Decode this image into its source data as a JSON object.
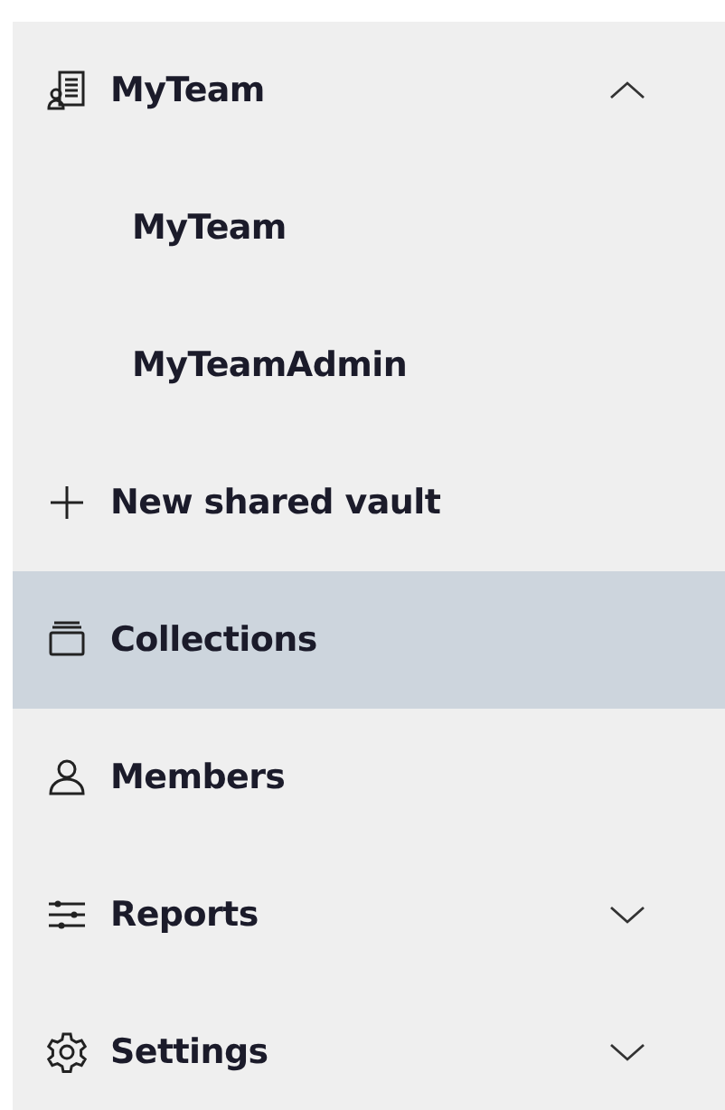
{
  "sidebar": {
    "items": [
      {
        "kind": "group",
        "label": "MyTeam",
        "expanded": true,
        "selected": false,
        "children": [
          {
            "label": "MyTeam",
            "selected": false
          },
          {
            "label": "MyTeamAdmin",
            "selected": false
          }
        ]
      },
      {
        "kind": "action",
        "label": "New shared vault",
        "selected": false
      },
      {
        "kind": "link",
        "label": "Collections",
        "selected": true
      },
      {
        "kind": "link",
        "label": "Members",
        "selected": false
      },
      {
        "kind": "group",
        "label": "Reports",
        "expanded": false,
        "selected": false
      },
      {
        "kind": "group",
        "label": "Settings",
        "expanded": false,
        "selected": false
      }
    ]
  }
}
